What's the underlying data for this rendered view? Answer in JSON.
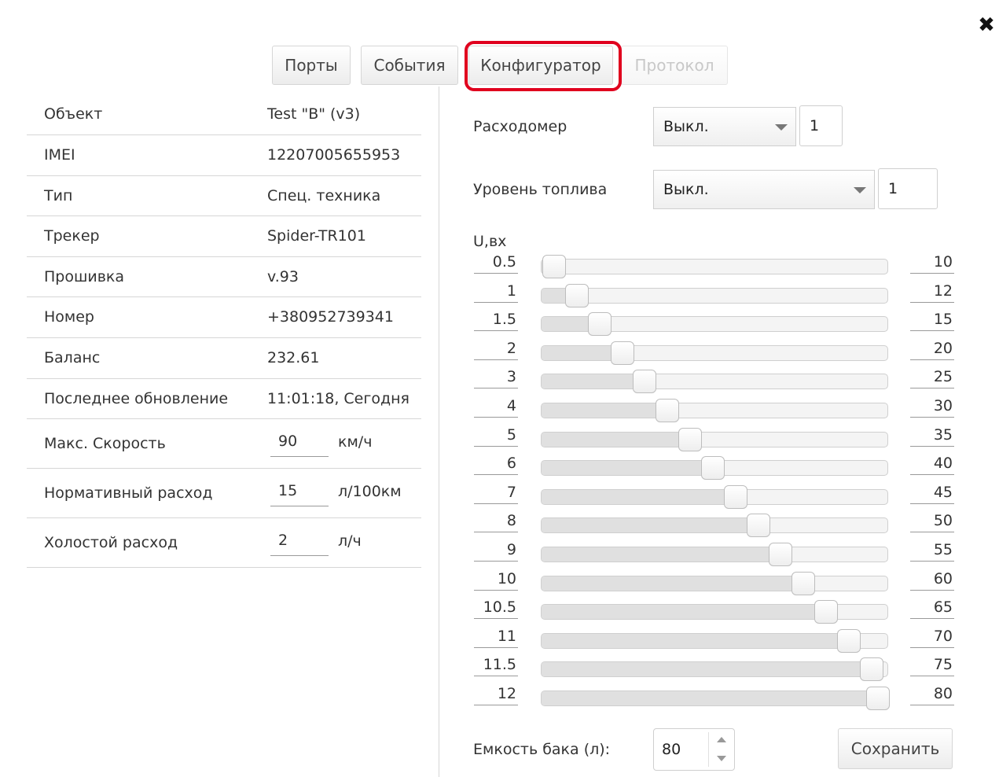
{
  "tabs": [
    {
      "label": "Порты",
      "state": "normal"
    },
    {
      "label": "События",
      "state": "normal"
    },
    {
      "label": "Конфигуратор",
      "state": "active"
    },
    {
      "label": "Протокол",
      "state": "disabled"
    }
  ],
  "close_icon": "close-icon",
  "highlight_color": "#e0001e",
  "info": {
    "object": {
      "label": "Объект",
      "value": "Test \"B\" (v3)"
    },
    "imei": {
      "label": "IMEI",
      "value": "12207005655953"
    },
    "type": {
      "label": "Тип",
      "value": "Спец. техника"
    },
    "tracker": {
      "label": "Трекер",
      "value": "Spider-TR101"
    },
    "firmware": {
      "label": "Прошивка",
      "value": "v.93"
    },
    "number": {
      "label": "Номер",
      "value": "+380952739341"
    },
    "balance": {
      "label": "Баланс",
      "value": "232.61"
    },
    "last_update": {
      "label": "Последнее обновление",
      "value": "11:01:18, Сегодня"
    },
    "max_speed": {
      "label": "Макс. Скорость",
      "value": "90",
      "unit": "км/ч"
    },
    "norm_consumption": {
      "label": "Нормативный расход",
      "value": "15",
      "unit": "л/100км"
    },
    "idle_consumption": {
      "label": "Холостой расход",
      "value": "2",
      "unit": "л/ч"
    }
  },
  "config": {
    "flowmeter": {
      "label": "Расходомер",
      "selected": "Выкл.",
      "value": "1"
    },
    "fuel_level": {
      "label": "Уровень топлива",
      "selected": "Выкл.",
      "value": "1"
    },
    "voltage_title": "U,вх",
    "sliders": [
      {
        "left": "0.5",
        "right": "10",
        "fraction": 0.0
      },
      {
        "left": "1",
        "right": "12",
        "fraction": 0.07
      },
      {
        "left": "1.5",
        "right": "15",
        "fraction": 0.14
      },
      {
        "left": "2",
        "right": "20",
        "fraction": 0.21
      },
      {
        "left": "3",
        "right": "25",
        "fraction": 0.28
      },
      {
        "left": "4",
        "right": "30",
        "fraction": 0.35
      },
      {
        "left": "5",
        "right": "35",
        "fraction": 0.42
      },
      {
        "left": "6",
        "right": "40",
        "fraction": 0.49
      },
      {
        "left": "7",
        "right": "45",
        "fraction": 0.56
      },
      {
        "left": "8",
        "right": "50",
        "fraction": 0.63
      },
      {
        "left": "9",
        "right": "55",
        "fraction": 0.7
      },
      {
        "left": "10",
        "right": "60",
        "fraction": 0.77
      },
      {
        "left": "10.5",
        "right": "65",
        "fraction": 0.84
      },
      {
        "left": "11",
        "right": "70",
        "fraction": 0.91
      },
      {
        "left": "11.5",
        "right": "75",
        "fraction": 0.98
      },
      {
        "left": "12",
        "right": "80",
        "fraction": 1.0
      }
    ],
    "tank_label": "Емкость бака (л):",
    "tank_value": "80",
    "save_label": "Сохранить"
  }
}
